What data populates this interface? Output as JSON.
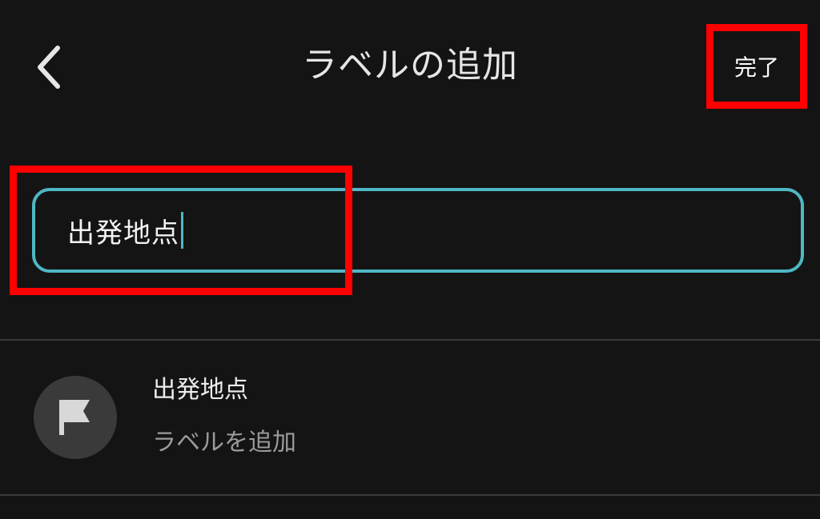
{
  "header": {
    "back_icon": "chevron-left-icon",
    "title": "ラベルの追加",
    "done_label": "完了"
  },
  "input": {
    "value": "出発地点"
  },
  "suggestion": {
    "icon": "flag-icon",
    "title": "出発地点",
    "subtitle": "ラベルを追加"
  },
  "colors": {
    "background": "#141414",
    "accent": "#4fb7c4",
    "annotation": "#ff0000",
    "divider": "#3a3a3a"
  }
}
